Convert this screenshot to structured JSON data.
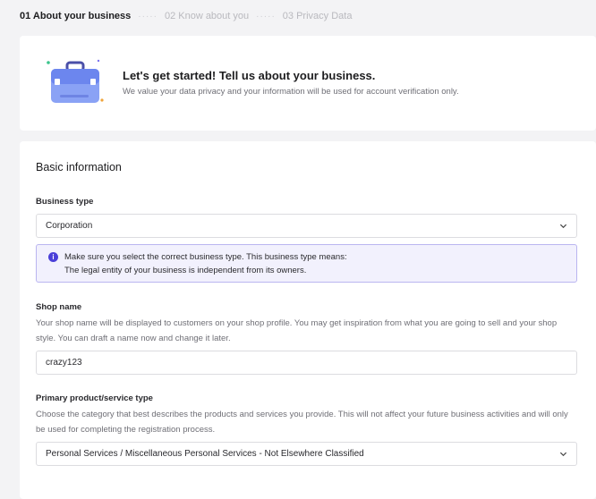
{
  "stepper": {
    "step1": "01 About your business",
    "step2": "02 Know about you",
    "step3": "03 Privacy Data",
    "separator": "·····"
  },
  "intro": {
    "icon": "briefcase-icon",
    "title": "Let's get started! Tell us about your business.",
    "subtitle": "We value your data privacy and your information will be used for account verification only."
  },
  "form": {
    "section_title": "Basic information",
    "business_type": {
      "label": "Business type",
      "value": "Corporation",
      "notice_line1": "Make sure you select the correct business type. This business type means:",
      "notice_line2": "The legal entity of your business is independent from its owners."
    },
    "shop_name": {
      "label": "Shop name",
      "help": "Your shop name will be displayed to customers on your shop profile. You may get inspiration from what you are going to sell and your shop style. You can draft a name now and change it later.",
      "value": "crazy123"
    },
    "product_type": {
      "label": "Primary product/service type",
      "help": "Choose the category that best describes the products and services you provide. This will not affect your future business activities and will only be used for completing the registration process.",
      "value": "Personal Services / Miscellaneous Personal Services - Not Elsewhere Classified"
    }
  },
  "colors": {
    "accent": "#4a3fd8",
    "notice_bg": "#f2f1fd",
    "page_bg": "#f3f3f5"
  }
}
